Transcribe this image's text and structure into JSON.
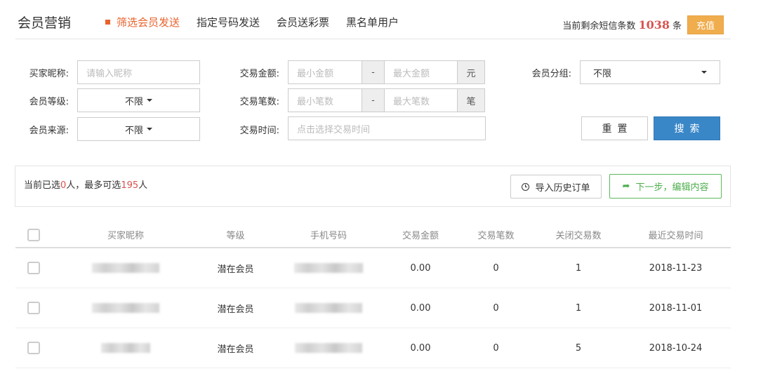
{
  "header": {
    "title": "会员营销",
    "tabs": [
      {
        "label": "筛选会员发送",
        "active": true
      },
      {
        "label": "指定号码发送",
        "active": false
      },
      {
        "label": "会员送彩票",
        "active": false
      },
      {
        "label": "黑名单用户",
        "active": false
      }
    ],
    "sms_prefix": "当前剩余短信条数",
    "sms_count": "1038",
    "sms_suffix": "条",
    "recharge_label": "充值"
  },
  "filters": {
    "nickname_label": "买家昵称:",
    "nickname_placeholder": "请输入昵称",
    "level_label": "会员等级:",
    "level_value": "不限",
    "source_label": "会员来源:",
    "source_value": "不限",
    "amount_label": "交易金额:",
    "amount_min_placeholder": "最小金额",
    "amount_sep": "-",
    "amount_max_placeholder": "最大金额",
    "amount_unit": "元",
    "count_label": "交易笔数:",
    "count_min_placeholder": "最小笔数",
    "count_sep": "-",
    "count_max_placeholder": "最大笔数",
    "count_unit": "笔",
    "time_label": "交易时间:",
    "time_placeholder": "点击选择交易时间",
    "group_label": "会员分组:",
    "group_value": "不限",
    "reset_label": "重置",
    "search_label": "搜索"
  },
  "selection": {
    "prefix": "当前已选",
    "selected": "0",
    "middle": "人，最多可选",
    "max": "195",
    "suffix": "人",
    "history_label": "导入历史订单",
    "next_label": "下一步，编辑内容"
  },
  "table": {
    "columns": [
      "买家昵称",
      "等级",
      "手机号码",
      "交易金额",
      "交易笔数",
      "关闭交易数",
      "最近交易时间"
    ],
    "rows": [
      {
        "level": "潜在会员",
        "amount": "0.00",
        "count": "0",
        "closed": "1",
        "last_time": "2018-11-23"
      },
      {
        "level": "潜在会员",
        "amount": "0.00",
        "count": "0",
        "closed": "1",
        "last_time": "2018-11-01"
      },
      {
        "level": "潜在会员",
        "amount": "0.00",
        "count": "0",
        "closed": "5",
        "last_time": "2018-10-24"
      }
    ]
  },
  "colors": {
    "accent": "#e8632c",
    "primary": "#3a87c8",
    "success": "#5cb85c",
    "warning": "#f0ad4e",
    "danger": "#d9534f"
  }
}
